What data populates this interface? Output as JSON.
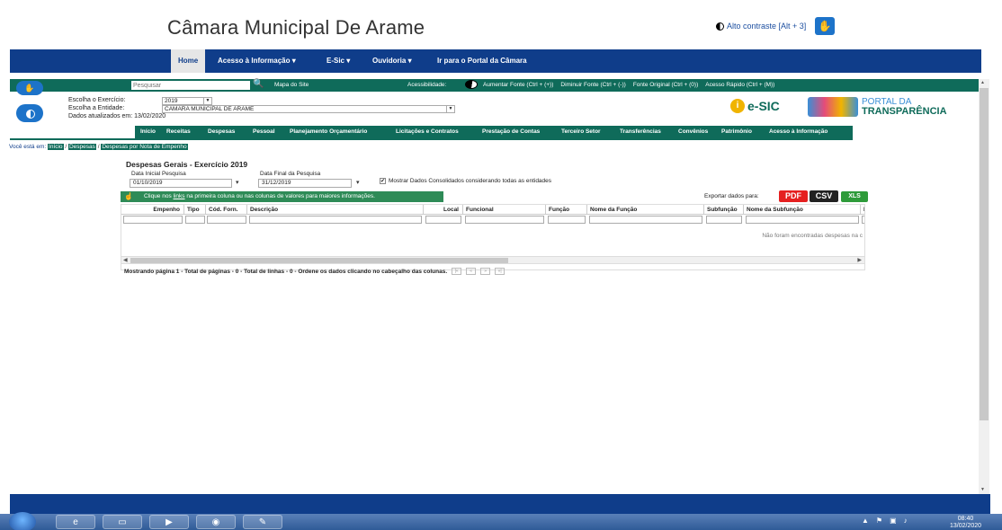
{
  "site": {
    "title": "Câmara Municipal De Arame",
    "contrast_link": "Alto contraste [Alt + 3]"
  },
  "main_nav": [
    {
      "label": "Home"
    },
    {
      "label": "Acesso à Informação ▾"
    },
    {
      "label": "E-Sic ▾"
    },
    {
      "label": "Ouvidoria ▾"
    },
    {
      "label": "Ir para o Portal da Câmara"
    }
  ],
  "access_bar": {
    "search_placeholder": "Pesquisar",
    "site_map": "Mapa do Site",
    "accessibility_label": "Acessibilidade:",
    "links": [
      "Aumentar Fonte (Ctrl + (+))",
      "Diminuir Fonte (Ctrl + (-))",
      "Fonte Original (Ctrl + (0))",
      "Acesso Rápido (Ctrl + (M))"
    ]
  },
  "filters": {
    "exercise_label": "Escolha o Exercício:",
    "exercise_value": "2019",
    "entity_label": "Escolha a Entidade:",
    "entity_value": "CAMARA MUNICIPAL DE ARAME",
    "updated": "Dados atualizados em: 13/02/2020"
  },
  "logos": {
    "esic": "e-SIC",
    "portal_line1": "PORTAL DA",
    "portal_line2": "TRANSPARÊNCIA"
  },
  "sub_nav": [
    "Início",
    "Receitas",
    "Despesas",
    "Pessoal",
    "Planejamento Orçamentário",
    "Licitações e Contratos",
    "Prestação de Contas",
    "Terceiro Setor",
    "Transferências",
    "Convênios",
    "Patrimônio",
    "Acesso à Informação"
  ],
  "breadcrumb": {
    "label": "Você está em:",
    "items": [
      "Início",
      "Despesas",
      "Despesas por Nota de Empenho"
    ],
    "sep": " / "
  },
  "page": {
    "title": "Despesas Gerais - Exercício 2019",
    "start_label": "Data Inicial Pesquisa",
    "start_value": "01/10/2019",
    "end_label": "Data Final da Pesquisa",
    "end_value": "31/12/2019",
    "consolidated_label": "Mostrar Dados Consolidados considerando todas as entidades",
    "consolidated_checked": "✔",
    "hint_pre": "Clique nos ",
    "hint_link": "links",
    "hint_post": " na primeira coluna ou nas colunas de valores para maiores informações.",
    "export_label": "Exportar dados para:",
    "export_pdf": "PDF",
    "export_csv": "CSV",
    "export_xls": "XLS"
  },
  "table": {
    "columns": [
      "Empenho",
      "Tipo",
      "Cód. Forn.",
      "Descrição",
      "Local",
      "Funcional",
      "Função",
      "Nome da Função",
      "Subfunção",
      "Nome da Subfunção",
      "N"
    ],
    "empty_message": "Não foram encontradas despesas na c"
  },
  "pager": {
    "text": "Mostrando página 1 - Total de páginas - 0 - Total de linhas - 0 - Ordene os dados clicando no cabeçalho das colunas.",
    "buttons": [
      "|«",
      "«",
      "»",
      "»|"
    ]
  },
  "taskbar": {
    "clock_time": "08:40",
    "clock_date": "13/02/2020"
  },
  "colors": {
    "nav_blue": "#0f3d8a",
    "access_green": "#0f6b5a",
    "pdf_red": "#e52020",
    "xls_green": "#2e9b3a"
  }
}
